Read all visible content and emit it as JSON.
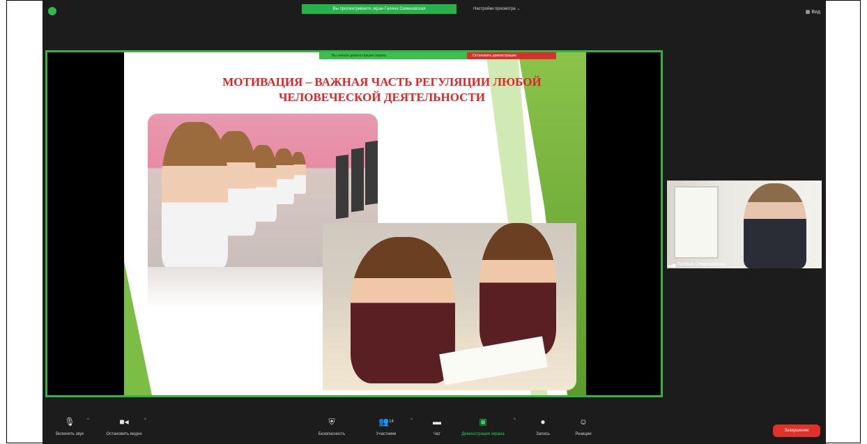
{
  "top_bar": {
    "share_banner": "Вы просматриваете экран Галина Семеновская",
    "view_options": "Настройки просмотра",
    "view_button": "Вид"
  },
  "share_toolbar": {
    "status": "Вы начали демонстрацию экрана",
    "stop": "Остановить демонстрацию"
  },
  "slide": {
    "title_line1": "МОТИВАЦИЯ – ВАЖНАЯ ЧАСТЬ РЕГУЛЯЦИИ ЛЮБОЙ",
    "title_line2": "ЧЕЛОВЕЧЕСКОЙ ДЕЯТЕЛЬНОСТИ"
  },
  "participant": {
    "name": "Галина Семеновская"
  },
  "toolbar": {
    "mute": "Включить звук",
    "video": "Остановить видео",
    "security": "Безопасность",
    "participants": "Участники",
    "participants_count": "14",
    "chat": "Чат",
    "share": "Демонстрация экрана",
    "record": "Запись",
    "reactions": "Реакции",
    "end": "Завершение"
  },
  "icons": [
    "shield-icon",
    "microphone-icon",
    "video-icon",
    "security-icon",
    "participants-icon",
    "chat-icon",
    "share-screen-icon",
    "record-icon",
    "reactions-icon",
    "signal-icon"
  ],
  "colors": {
    "accent_green": "#2fb84d",
    "end_red": "#e0312b",
    "title_red": "#e02323"
  }
}
